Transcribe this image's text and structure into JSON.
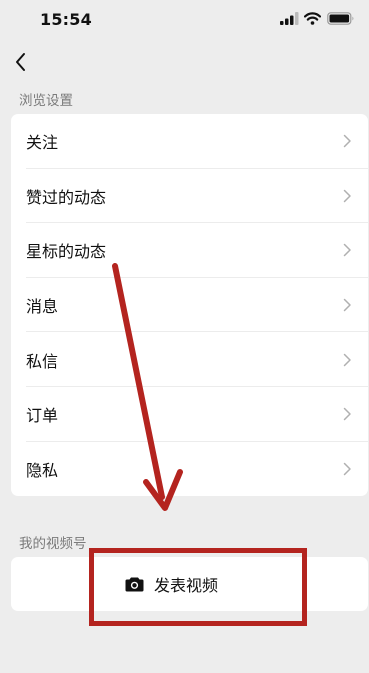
{
  "status_bar": {
    "time": "15:54",
    "icons": [
      "signal-icon",
      "wifi-icon",
      "battery-icon"
    ]
  },
  "nav": {
    "back_icon": "chevron-left-icon"
  },
  "browse_settings": {
    "title": "浏览设置",
    "items": [
      {
        "label": "关注"
      },
      {
        "label": "赞过的动态"
      },
      {
        "label": "星标的动态"
      },
      {
        "label": "消息"
      },
      {
        "label": "私信"
      },
      {
        "label": "订单"
      },
      {
        "label": "隐私"
      }
    ]
  },
  "my_channel": {
    "title": "我的视频号",
    "publish_label": "发表视频",
    "publish_icon": "camera-icon"
  },
  "annotation": {
    "color": "#b4241f",
    "shapes": [
      "arrow",
      "rectangle"
    ]
  }
}
